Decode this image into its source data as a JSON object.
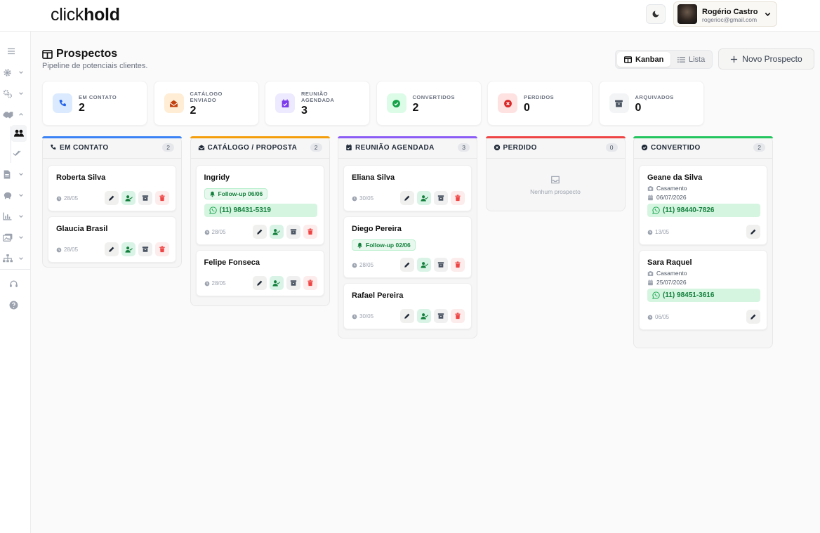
{
  "app": {
    "logo_light": "click",
    "logo_bold": "hold"
  },
  "user": {
    "name": "Rogério Castro",
    "email": "rogerioc@gmail.com"
  },
  "page": {
    "title": "Prospectos",
    "subtitle": "Pipeline de potenciais clientes."
  },
  "view_toggle": {
    "kanban": "Kanban",
    "lista": "Lista",
    "active": "Kanban"
  },
  "new_button": "Novo Prospecto",
  "stats": [
    {
      "label": "EM CONTATO",
      "value": "2",
      "icon": "phone-icon",
      "color": "#2563eb"
    },
    {
      "label": "CATÁLOGO ENVIADO",
      "value": "2",
      "icon": "envelope-open-icon",
      "color": "#c2410c"
    },
    {
      "label": "REUNIÃO AGENDADA",
      "value": "3",
      "icon": "calendar-check-icon",
      "color": "#7c3aed"
    },
    {
      "label": "CONVERTIDOS",
      "value": "2",
      "icon": "check-circle-icon",
      "color": "#16a34a"
    },
    {
      "label": "PERDIDOS",
      "value": "0",
      "icon": "x-circle-icon",
      "color": "#dc2626"
    },
    {
      "label": "ARQUIVADOS",
      "value": "0",
      "icon": "archive-icon",
      "color": "#4b5563"
    }
  ],
  "columns": [
    {
      "title": "EM CONTATO",
      "count": "2",
      "color": "#3b82f6",
      "icon": "phone-icon",
      "cards": [
        {
          "name": "Roberta Silva",
          "date": "28/05"
        },
        {
          "name": "Glaucia Brasil",
          "date": "28/05"
        }
      ]
    },
    {
      "title": "CATÁLOGO / PROPOSTA",
      "count": "2",
      "color": "#f59e0b",
      "icon": "envelope-open-icon",
      "cards": [
        {
          "name": "Ingridy",
          "followup": "Follow-up 06/06",
          "phone": "(11) 98431-5319",
          "date": "28/05"
        },
        {
          "name": "Felipe Fonseca",
          "date": "28/05"
        }
      ]
    },
    {
      "title": "REUNIÃO AGENDADA",
      "count": "3",
      "color": "#8b5cf6",
      "icon": "calendar-check-icon",
      "cards": [
        {
          "name": "Eliana Silva",
          "date": "30/05"
        },
        {
          "name": "Diego Pereira",
          "followup": "Follow-up 02/06",
          "date": "28/05"
        },
        {
          "name": "Rafael Pereira",
          "date": "30/05"
        }
      ]
    },
    {
      "title": "PERDIDO",
      "count": "0",
      "color": "#ef4444",
      "icon": "x-circle-icon",
      "empty": "Nenhum prospecto",
      "cards": []
    },
    {
      "title": "CONVERTIDO",
      "count": "2",
      "color": "#22c55e",
      "icon": "check-circle-icon",
      "cards": [
        {
          "name": "Geane da Silva",
          "event": "Casamento",
          "event_date": "06/07/2026",
          "phone": "(11) 98440-7826",
          "date": "13/05"
        },
        {
          "name": "Sara Raquel",
          "event": "Casamento",
          "event_date": "25/07/2026",
          "phone": "(11) 98451-3616",
          "date": "06/05"
        }
      ]
    }
  ]
}
